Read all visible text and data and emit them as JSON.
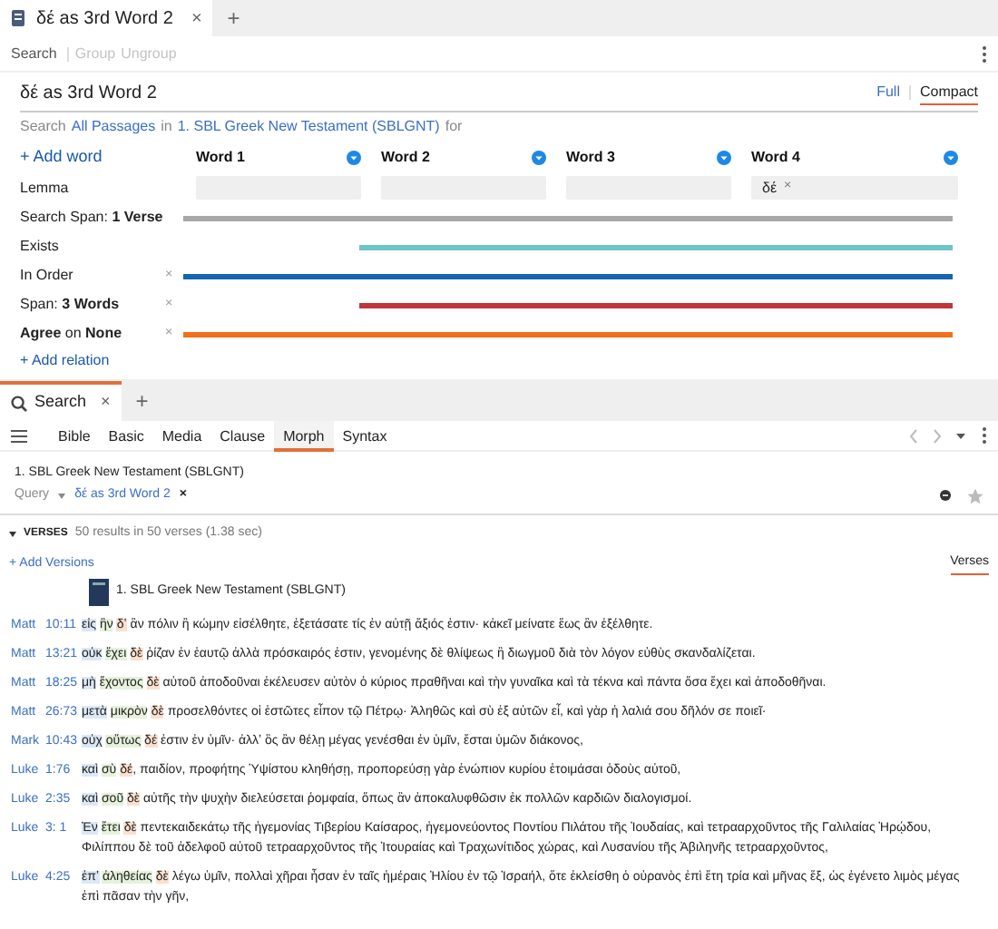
{
  "top_tabs": [
    {
      "label": "δέ as 3rd Word 2",
      "close": "×",
      "selected": true
    }
  ],
  "top_tab_add": "+",
  "toolbar": [
    {
      "label": "Search",
      "disabled": false
    },
    {
      "label": "Group",
      "disabled": true
    },
    {
      "label": "Ungroup",
      "disabled": true
    }
  ],
  "query_title": "δέ as 3rd Word 2",
  "view_modes": [
    {
      "label": "Full",
      "selected": false
    },
    {
      "label": "Compact",
      "selected": true
    }
  ],
  "scope_line": [
    {
      "text": "Search",
      "kind": "plain"
    },
    {
      "text": "All Passages",
      "kind": "link"
    },
    {
      "text": "in",
      "kind": "plain"
    },
    {
      "text": "1. SBL Greek New Testament (SBLGNT)",
      "kind": "link"
    },
    {
      "text": "for",
      "kind": "plain"
    }
  ],
  "add_word": "+ Add word",
  "words": [
    {
      "label": "Word 1"
    },
    {
      "label": "Word 2"
    },
    {
      "label": "Word 3"
    },
    {
      "label": "Word 4",
      "lemma": "δέ",
      "remove": "×"
    }
  ],
  "lemma_label": "Lemma",
  "relations": [
    {
      "label": "Search Span: **1 Verse**",
      "kind": "full",
      "color": "#a8a8a8"
    },
    {
      "label": "Exists",
      "kind": "partial",
      "color": "#6cc6c6"
    },
    {
      "label": "In Order",
      "kind": "full",
      "color": "#1565b0",
      "remove": "×"
    },
    {
      "label": "Span: **3 Words**",
      "kind": "partial",
      "color": "#c0363a",
      "remove": "×"
    },
    {
      "label": "**Agree** on **None**",
      "kind": "full",
      "color": "#f0711d",
      "remove": "×"
    }
  ],
  "add_relation": "+ Add relation",
  "bottom_tabs": [
    {
      "label": "Search",
      "close": "×",
      "selected": true
    }
  ],
  "bottom_tab_add": "+",
  "search_types": [
    {
      "label": "Bible",
      "selected": false
    },
    {
      "label": "Basic",
      "selected": false
    },
    {
      "label": "Media",
      "selected": false
    },
    {
      "label": "Clause",
      "selected": false
    },
    {
      "label": "Morph",
      "selected": true
    },
    {
      "label": "Syntax",
      "selected": false
    }
  ],
  "resource": "1. SBL Greek New Testament (SBLGNT)",
  "query_label": "Query",
  "query_value": "δέ as 3rd Word 2",
  "query_clear": "×",
  "results_heading": "VERSES",
  "results_summary": "50 results in 50 verses (1.38 sec)",
  "add_versions": "+ Add Versions",
  "verses_tab": "Verses",
  "column_title": "1. SBL Greek New Testament (SBLGNT)",
  "verses": [
    {
      "book": "Matt",
      "ref": "10:11",
      "words": [
        "εἰς",
        "ἣν",
        "δʼ"
      ],
      "rest": "ἂν πόλιν ἢ κώμην εἰσέλθητε, ἐξετάσατε τίς ἐν αὐτῇ ἄξιός ἐστιν· κἀκεῖ μείνατε ἕως ἂν ἐξέλθητε."
    },
    {
      "book": "Matt",
      "ref": "13:21",
      "words": [
        "οὐκ",
        "ἔχει",
        "δὲ"
      ],
      "rest": "ῥίζαν ἐν ἑαυτῷ ἀλλὰ πρόσκαιρός ἐστιν, γενομένης δὲ θλίψεως ἢ διωγμοῦ διὰ τὸν λόγον εὐθὺς σκανδαλίζεται."
    },
    {
      "book": "Matt",
      "ref": "18:25",
      "words": [
        "μὴ",
        "ἔχοντος",
        "δὲ"
      ],
      "rest": "αὐτοῦ ἀποδοῦναι ἐκέλευσεν αὐτὸν ὁ κύριος πραθῆναι καὶ τὴν γυναῖκα καὶ τὰ τέκνα καὶ πάντα ὅσα ἔχει καὶ ἀποδοθῆναι."
    },
    {
      "book": "Matt",
      "ref": "26:73",
      "words": [
        "μετὰ",
        "μικρὸν",
        "δὲ"
      ],
      "rest": "προσελθόντες οἱ ἑστῶτες εἶπον τῷ Πέτρῳ· Ἀληθῶς καὶ σὺ ἐξ αὐτῶν εἶ, καὶ γὰρ ἡ λαλιά σου δῆλόν σε ποιεῖ·"
    },
    {
      "book": "Mark",
      "ref": "10:43",
      "words": [
        "οὐχ",
        "οὕτως",
        "δέ"
      ],
      "rest": "ἐστιν ἐν ὑμῖν· ἀλλʼ ὃς ἂν θέλῃ μέγας γενέσθαι ἐν ὑμῖν, ἔσται ὑμῶν διάκονος,"
    },
    {
      "book": "Luke",
      "ref": "1:76",
      "words": [
        "καὶ",
        "σὺ",
        "δέ"
      ],
      "rest_attached": true,
      "rest": ", παιδίον, προφήτης Ὑψίστου κληθήσῃ, προπορεύσῃ γὰρ ἐνώπιον κυρίου ἑτοιμάσαι ὁδοὺς αὐτοῦ,"
    },
    {
      "book": "Luke",
      "ref": "2:35",
      "words": [
        "καὶ",
        "σοῦ",
        "δὲ"
      ],
      "rest": "αὐτῆς τὴν ψυχὴν διελεύσεται ῥομφαία, ὅπως ἂν ἀποκαλυφθῶσιν ἐκ πολλῶν καρδιῶν διαλογισμοί."
    },
    {
      "book": "Luke",
      "ref": "3: 1",
      "words": [
        "Ἐν",
        "ἔτει",
        "δὲ"
      ],
      "rest": "πεντεκαιδεκάτῳ τῆς ἡγεμονίας Τιβερίου Καίσαρος, ἡγεμονεύοντος Ποντίου Πιλάτου τῆς Ἰουδαίας, καὶ τετρααρχοῦντος τῆς Γαλιλαίας Ἡρῴδου, Φιλίππου δὲ τοῦ ἀδελφοῦ αὐτοῦ τετρααρχοῦντος τῆς Ἰτουραίας καὶ Τραχωνίτιδος χώρας, καὶ Λυσανίου τῆς Ἀβιληνῆς τετρααρχοῦντος,"
    },
    {
      "book": "Luke",
      "ref": "4:25",
      "words": [
        "ἐπʼ",
        "ἀληθείας",
        "δὲ"
      ],
      "rest": "λέγω ὑμῖν, πολλαὶ χῆραι ἦσαν ἐν ταῖς ἡμέραις Ἠλίου ἐν τῷ Ἰσραήλ, ὅτε ἐκλείσθη ὁ οὐρανὸς ἐπὶ ἔτη τρία καὶ μῆνας ἕξ, ὡς ἐγένετο λιμὸς μέγας ἐπὶ πᾶσαν τὴν γῆν,"
    }
  ]
}
